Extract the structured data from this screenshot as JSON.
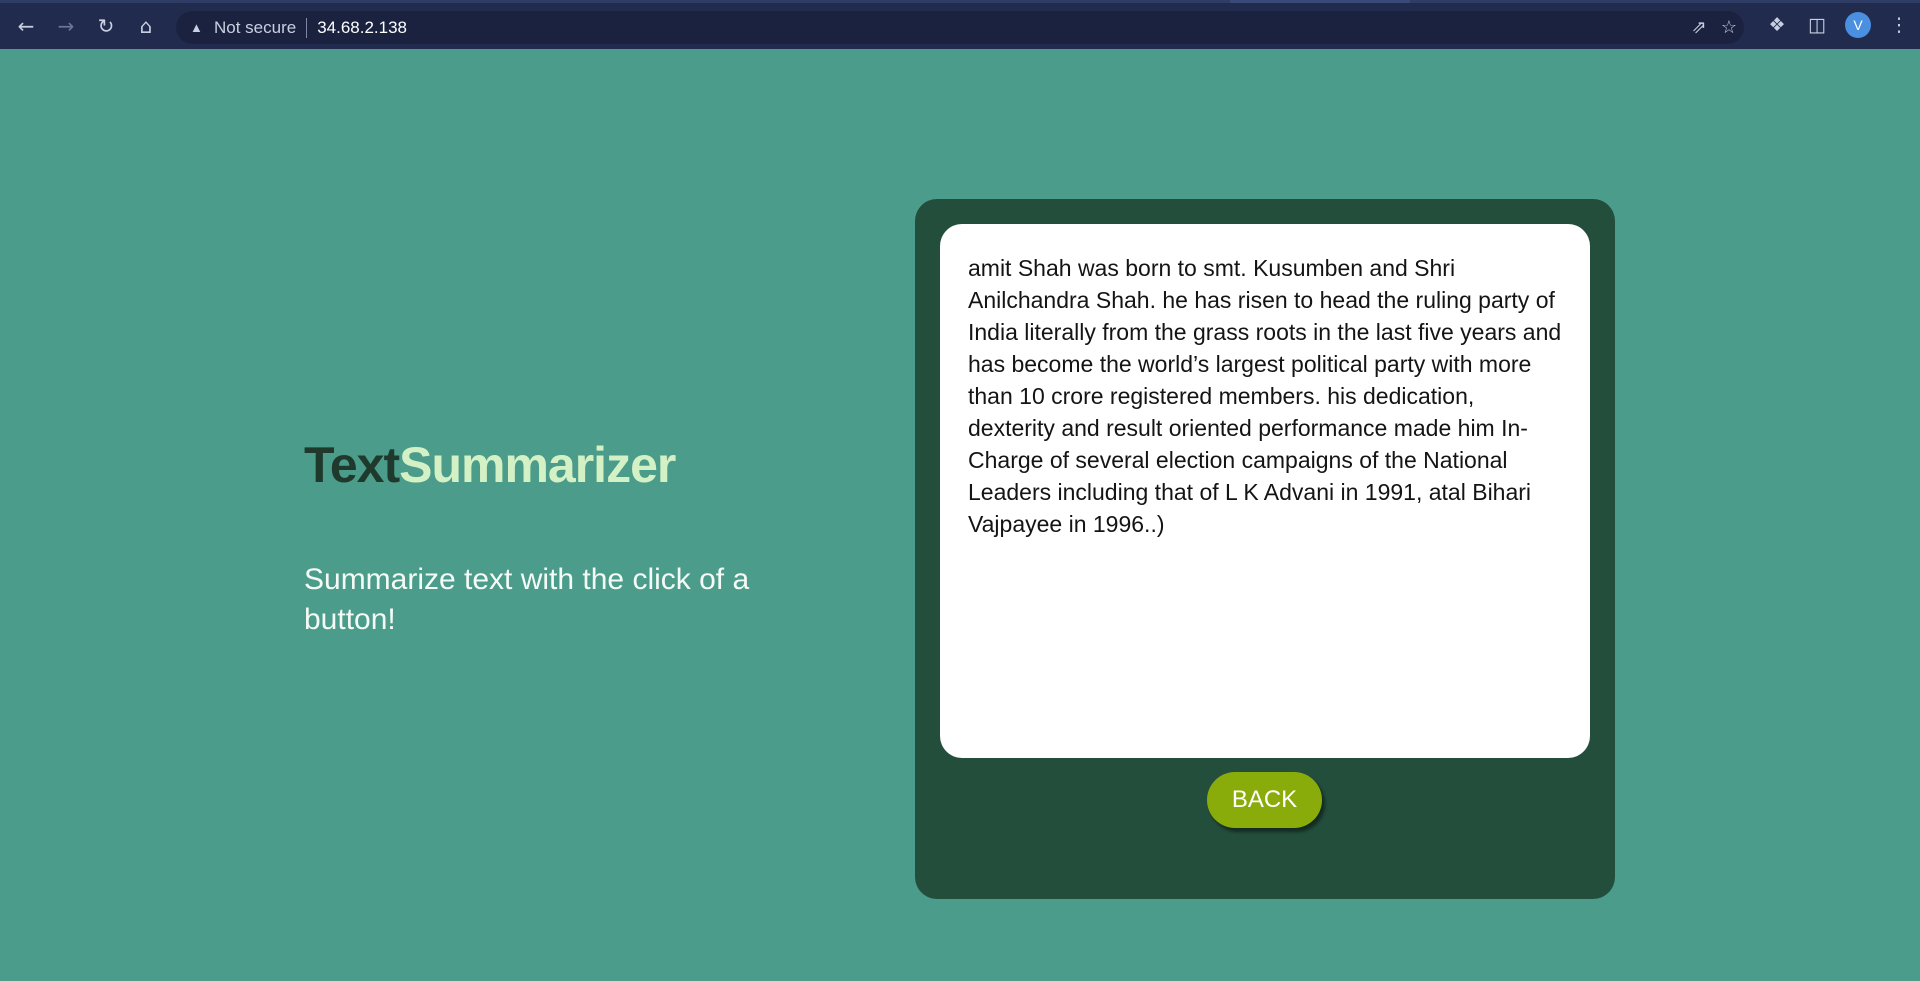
{
  "browser": {
    "security_label": "Not secure",
    "url": "34.68.2.138",
    "avatar_initial": "V",
    "icons": [
      "back-arrow-icon",
      "forward-arrow-icon",
      "reload-icon",
      "home-icon",
      "warning-icon",
      "share-icon",
      "star-icon",
      "extensions-icon",
      "side-panel-icon",
      "menu-dots-icon"
    ]
  },
  "hero": {
    "title_part1": "Text",
    "title_part2": "Summarizer",
    "tagline": "Summarize text with the click of a button!"
  },
  "card": {
    "text": "amit Shah was born to smt. Kusumben and Shri Anilchandra Shah. he has risen to head the ruling party of India literally from the grass roots in the last five years and has become the world’s largest political party with more than 10 crore registered members. his dedication, dexterity and result oriented performance made him In-Charge of several election campaigns of the National Leaders including that of L K Advani in 1991, atal Bihari Vajpayee in 1996..)",
    "back_label": "BACK"
  },
  "colors": {
    "background": "#4b9c8a",
    "card": "#234e3c",
    "button": "#8aac0b",
    "title_dark": "#1f3a2d",
    "title_light": "#d4f1c6"
  }
}
